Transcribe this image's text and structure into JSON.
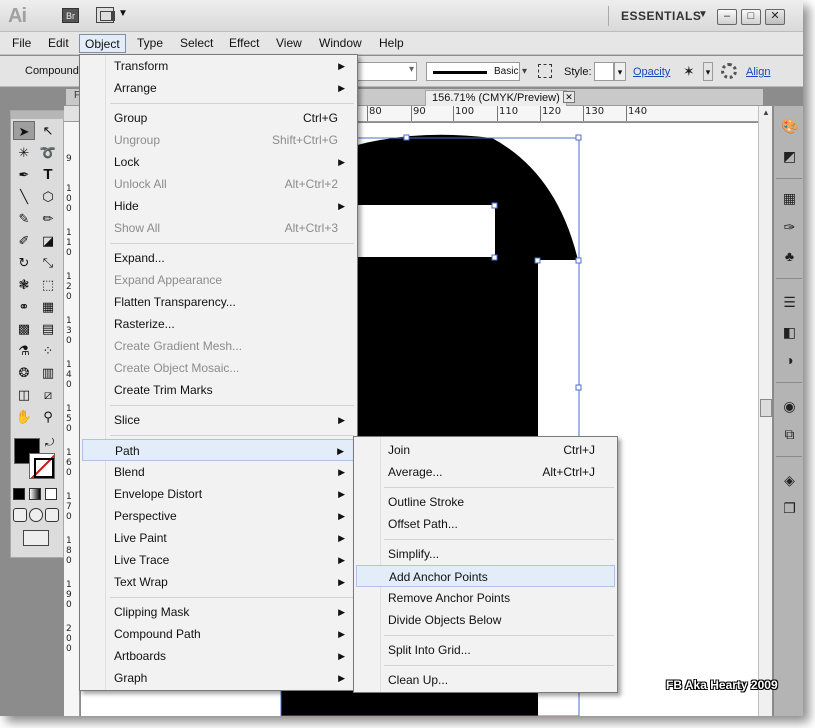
{
  "app": {
    "logo": "Ai",
    "bridge_button": "Br",
    "workspace": "ESSENTIALS",
    "window_buttons": {
      "minimize": "–",
      "restore": "□",
      "close": "✕"
    }
  },
  "menubar": {
    "items": [
      "File",
      "Edit",
      "Object",
      "Type",
      "Select",
      "Effect",
      "View",
      "Window",
      "Help"
    ]
  },
  "control_bar": {
    "selection_label": "Compound",
    "stroke_profile": "Basic",
    "style_label": "Style:",
    "opacity_link": "Opacity",
    "align_link": "Align"
  },
  "document": {
    "tab_title": "156.71% (CMYK/Preview)",
    "tab_close": "✕",
    "partial_tab_letter": "F",
    "ruler_h_labels": [
      "80",
      "90",
      "100",
      "110",
      "120",
      "130",
      "140"
    ],
    "ruler_v_labels": [
      "9",
      "1 0 0",
      "1 1 0",
      "1 2 0",
      "1 3 0",
      "1 4 0",
      "1 5 0",
      "1 6 0",
      "1 7 0",
      "1 8 0",
      "1 9 0",
      "2 0 0"
    ]
  },
  "object_menu": {
    "items": [
      {
        "label": "Transform",
        "shortcut": "",
        "submenu": true,
        "disabled": false
      },
      {
        "label": "Arrange",
        "shortcut": "",
        "submenu": true,
        "disabled": false
      },
      {
        "label": "Group",
        "shortcut": "Ctrl+G",
        "submenu": false,
        "disabled": false
      },
      {
        "label": "Ungroup",
        "shortcut": "Shift+Ctrl+G",
        "submenu": false,
        "disabled": true
      },
      {
        "label": "Lock",
        "shortcut": "",
        "submenu": true,
        "disabled": false
      },
      {
        "label": "Unlock All",
        "shortcut": "Alt+Ctrl+2",
        "submenu": false,
        "disabled": true
      },
      {
        "label": "Hide",
        "shortcut": "",
        "submenu": true,
        "disabled": false
      },
      {
        "label": "Show All",
        "shortcut": "Alt+Ctrl+3",
        "submenu": false,
        "disabled": true
      },
      {
        "label": "Expand...",
        "shortcut": "",
        "submenu": false,
        "disabled": false
      },
      {
        "label": "Expand Appearance",
        "shortcut": "",
        "submenu": false,
        "disabled": true
      },
      {
        "label": "Flatten Transparency...",
        "shortcut": "",
        "submenu": false,
        "disabled": false
      },
      {
        "label": "Rasterize...",
        "shortcut": "",
        "submenu": false,
        "disabled": false
      },
      {
        "label": "Create Gradient Mesh...",
        "shortcut": "",
        "submenu": false,
        "disabled": true
      },
      {
        "label": "Create Object Mosaic...",
        "shortcut": "",
        "submenu": false,
        "disabled": true
      },
      {
        "label": "Create Trim Marks",
        "shortcut": "",
        "submenu": false,
        "disabled": false
      },
      {
        "label": "Slice",
        "shortcut": "",
        "submenu": true,
        "disabled": false
      },
      {
        "label": "Path",
        "shortcut": "",
        "submenu": true,
        "disabled": false,
        "highlighted": true
      },
      {
        "label": "Blend",
        "shortcut": "",
        "submenu": true,
        "disabled": false
      },
      {
        "label": "Envelope Distort",
        "shortcut": "",
        "submenu": true,
        "disabled": false
      },
      {
        "label": "Perspective",
        "shortcut": "",
        "submenu": true,
        "disabled": false
      },
      {
        "label": "Live Paint",
        "shortcut": "",
        "submenu": true,
        "disabled": false
      },
      {
        "label": "Live Trace",
        "shortcut": "",
        "submenu": true,
        "disabled": false
      },
      {
        "label": "Text Wrap",
        "shortcut": "",
        "submenu": true,
        "disabled": false
      },
      {
        "label": "Clipping Mask",
        "shortcut": "",
        "submenu": true,
        "disabled": false
      },
      {
        "label": "Compound Path",
        "shortcut": "",
        "submenu": true,
        "disabled": false
      },
      {
        "label": "Artboards",
        "shortcut": "",
        "submenu": true,
        "disabled": false
      },
      {
        "label": "Graph",
        "shortcut": "",
        "submenu": true,
        "disabled": false
      }
    ]
  },
  "path_menu": {
    "items": [
      {
        "label": "Join",
        "shortcut": "Ctrl+J"
      },
      {
        "label": "Average...",
        "shortcut": "Alt+Ctrl+J"
      },
      {
        "label": "Outline Stroke",
        "shortcut": ""
      },
      {
        "label": "Offset Path...",
        "shortcut": ""
      },
      {
        "label": "Simplify...",
        "shortcut": ""
      },
      {
        "label": "Add Anchor Points",
        "shortcut": "",
        "highlighted": true
      },
      {
        "label": "Remove Anchor Points",
        "shortcut": ""
      },
      {
        "label": "Divide Objects Below",
        "shortcut": ""
      },
      {
        "label": "Split Into Grid...",
        "shortcut": ""
      },
      {
        "label": "Clean Up...",
        "shortcut": ""
      }
    ]
  },
  "watermark": "FB Aka Hearty 2009",
  "colors": {
    "accent_link": "#1a47b8",
    "selection_bounds": "#4a6fd0",
    "fill": "#000000",
    "highlight": "#e3ecf9"
  },
  "icons": {
    "submenu_arrow": "▶",
    "dropdown": "▾"
  }
}
